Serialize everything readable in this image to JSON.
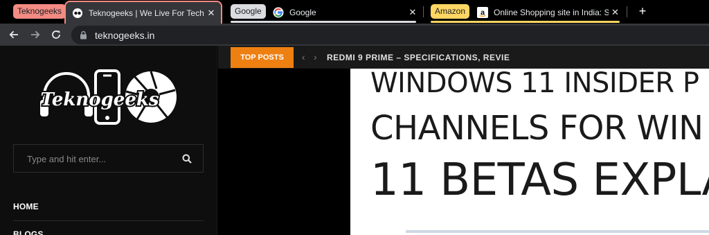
{
  "tabs": {
    "groups": [
      {
        "label": "Teknogeeks",
        "color": "#f28b82"
      },
      {
        "label": "Google",
        "color": "#dadce0"
      },
      {
        "label": "Amazon",
        "color": "#fdd663"
      }
    ],
    "items": [
      {
        "title": "Teknogeeks | We Live For Tech",
        "favicon": "teknogeeks-favicon",
        "active": true
      },
      {
        "title": "Google",
        "favicon": "google-g-icon",
        "active": false
      },
      {
        "title": "Online Shopping site in India: Sh",
        "favicon": "amazon-a-icon",
        "active": false
      }
    ],
    "new_tab_label": "+",
    "close_glyph": "✕"
  },
  "toolbar": {
    "url": "teknogeeks.in",
    "icons": [
      "back-arrow-icon",
      "forward-arrow-icon",
      "reload-icon",
      "lock-icon"
    ]
  },
  "sidebar": {
    "search_placeholder": "Type and hit enter...",
    "menu": [
      "HOME",
      "BLOGS"
    ]
  },
  "topbar": {
    "top_posts_label": "TOP POSTS",
    "prev_glyph": "‹",
    "next_glyph": "›",
    "ticker_text": "REDMI 9 PRIME – SPECIFICATIONS, REVIE"
  },
  "hero": {
    "lines": [
      "WINDOWS 11 INSIDER P",
      "CHANNELS FOR WIN",
      "11 BETAS EXPLA"
    ]
  },
  "colors": {
    "accent_orange": "#ee8012",
    "group_red": "#f28b82",
    "group_grey": "#dadce0",
    "group_yellow": "#fdd663"
  }
}
